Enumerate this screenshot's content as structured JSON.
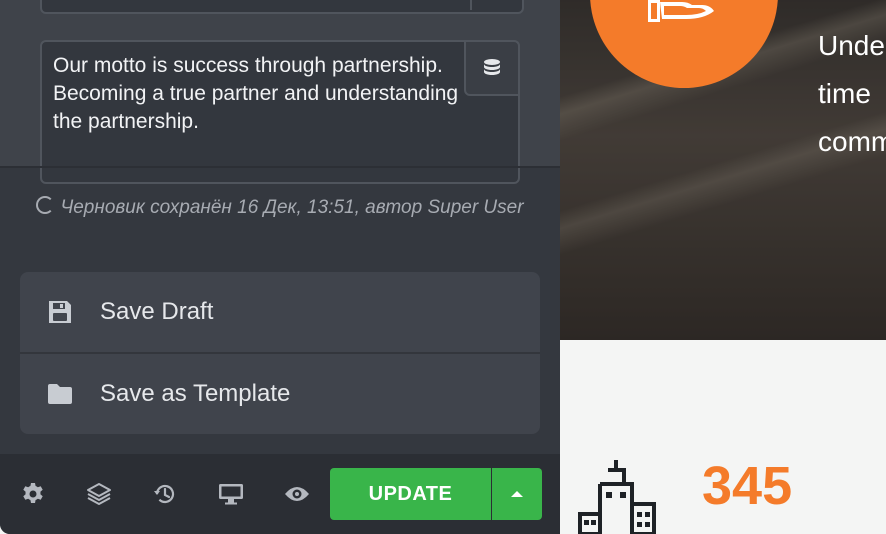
{
  "editor": {
    "textarea_value": "Our motto is success through partnership. Becoming a true partner and understanding the partnership.",
    "dynamic_icon": "database-icon",
    "status_text": "Черновик сохранён 16 Дек, 13:51, автор Super User",
    "menu": [
      {
        "label": "Save Draft",
        "icon": "floppy-disk-icon"
      },
      {
        "label": "Save as Template",
        "icon": "folder-icon"
      }
    ],
    "footer_icons": [
      "gear-icon",
      "layers-icon",
      "history-icon",
      "desktop-icon",
      "eye-icon"
    ],
    "update_label": "UPDATE",
    "colors": {
      "panel": "#34383f",
      "update": "#39b54a"
    }
  },
  "preview": {
    "hero_lines": [
      "Unde",
      "time",
      "comm"
    ],
    "stat_value": "345",
    "accent": "#f47b2a"
  }
}
